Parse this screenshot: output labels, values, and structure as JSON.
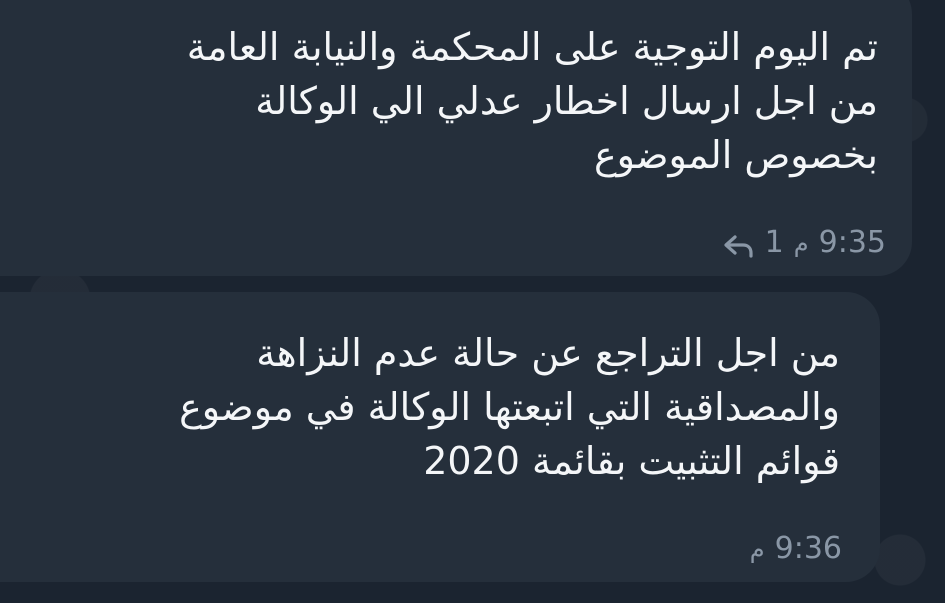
{
  "messages": [
    {
      "lines": [
        "تم اليوم التوجية على المحكمة والنيابة  العامة",
        "من اجل ارسال اخطار عدلي الي الوكالة",
        "بخصوص الموضوع"
      ],
      "reply_count": "1",
      "time_suffix": "م",
      "time": "9:35",
      "reply_icon": "reply-arrow-icon"
    },
    {
      "lines": [
        "من اجل التراجع عن حالة عدم النزاهة",
        "والمصداقية التي اتبعتها الوكالة في موضوع",
        "قوائم التثبيت بقائمة 2020"
      ],
      "time_suffix": "م",
      "time": "9:36"
    }
  ],
  "colors": {
    "background": "#1b2430",
    "bubble": "#252f3b",
    "text": "#f4f6f8",
    "meta": "#8a97a6"
  }
}
